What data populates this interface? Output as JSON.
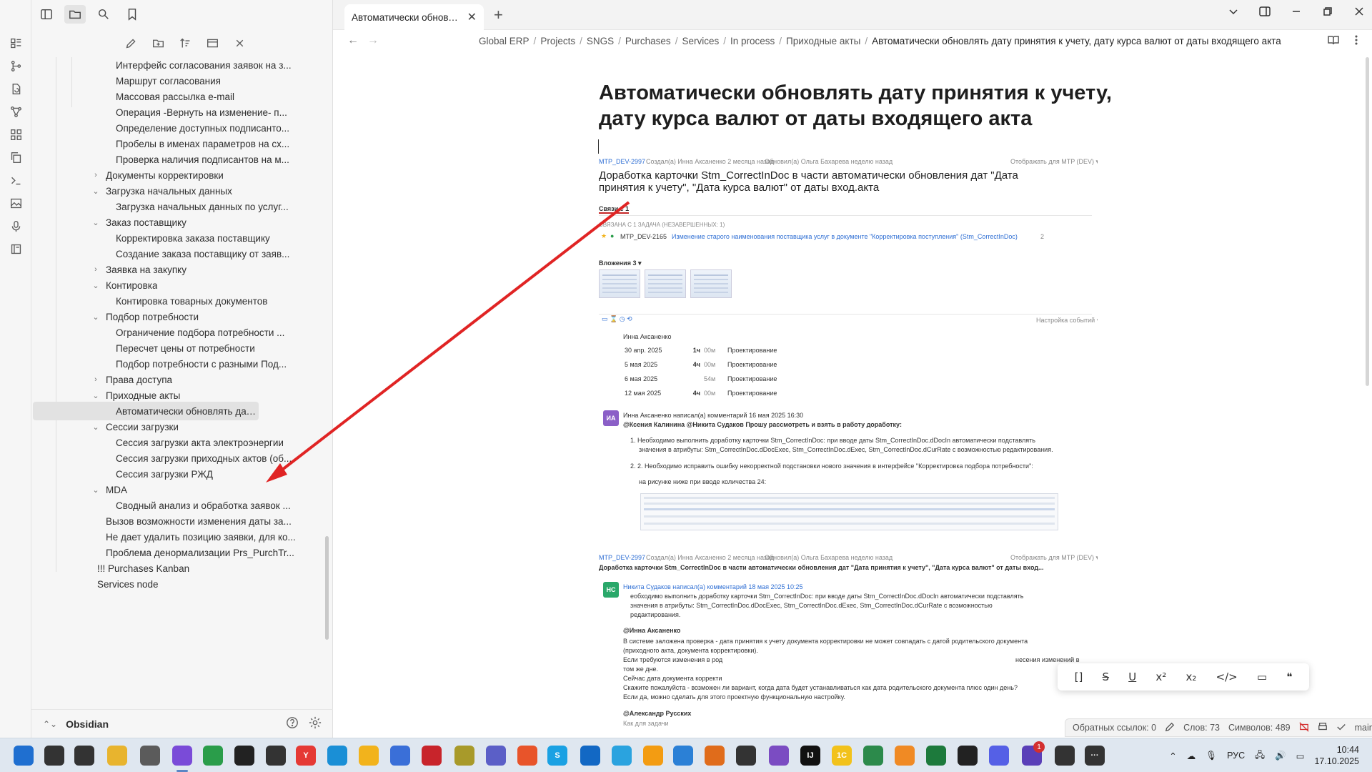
{
  "ribbon": {
    "icons": [
      "dashboard-icon",
      "git-icon",
      "document-refresh-icon",
      "graph-icon",
      "grid-icon",
      "copy-icon",
      "terminal-icon",
      "image-icon",
      "microphone-icon",
      "book-icon"
    ]
  },
  "sidebar": {
    "top_icons": [
      "sidebar-toggle-icon",
      "folder-icon",
      "search-icon",
      "bookmark-icon"
    ],
    "actions": [
      "new-note-icon",
      "new-folder-icon",
      "sort-icon",
      "collapse-icon",
      "close-all-icon"
    ],
    "tree": [
      {
        "label": "Интерфейс согласования заявок на з...",
        "level": 2,
        "folder": false
      },
      {
        "label": "Маршрут согласования",
        "level": 2,
        "folder": false
      },
      {
        "label": "Массовая рассылка e-mail",
        "level": 2,
        "folder": false
      },
      {
        "label": "Операция -Вернуть на изменение- п...",
        "level": 2,
        "folder": false
      },
      {
        "label": "Определение доступных подписанто...",
        "level": 2,
        "folder": false
      },
      {
        "label": "Пробелы в именах параметров на сх...",
        "level": 2,
        "folder": false
      },
      {
        "label": "Проверка наличия подписантов на м...",
        "level": 2,
        "folder": false
      },
      {
        "label": "Документы корректировки",
        "level": 1,
        "folder": true,
        "open": false
      },
      {
        "label": "Загрузка начальных данных",
        "level": 1,
        "folder": true,
        "open": true
      },
      {
        "label": "Загрузка начальных данных по услуг...",
        "level": 2,
        "folder": false
      },
      {
        "label": "Заказ поставщику",
        "level": 1,
        "folder": true,
        "open": true
      },
      {
        "label": "Корректировка заказа поставщику",
        "level": 2,
        "folder": false
      },
      {
        "label": "Создание заказа поставщику от заяв...",
        "level": 2,
        "folder": false
      },
      {
        "label": "Заявка на закупку",
        "level": 1,
        "folder": true,
        "open": false
      },
      {
        "label": "Контировка",
        "level": 1,
        "folder": true,
        "open": true
      },
      {
        "label": "Контировка товарных документов",
        "level": 2,
        "folder": false
      },
      {
        "label": "Подбор потребности",
        "level": 1,
        "folder": true,
        "open": true
      },
      {
        "label": "Ограничение подбора потребности ...",
        "level": 2,
        "folder": false
      },
      {
        "label": "Пересчет цены от потребности",
        "level": 2,
        "folder": false
      },
      {
        "label": "Подбор потребности с разными Под...",
        "level": 2,
        "folder": false
      },
      {
        "label": "Права доступа",
        "level": 1,
        "folder": true,
        "open": false
      },
      {
        "label": "Приходные акты",
        "level": 1,
        "folder": true,
        "open": true
      },
      {
        "label": "Автоматически обновлять дату прин...",
        "level": 2,
        "folder": false,
        "selected": true
      },
      {
        "label": "Сессии загрузки",
        "level": 1,
        "folder": true,
        "open": true
      },
      {
        "label": "Сессия загрузки акта электроэнергии",
        "level": 2,
        "folder": false
      },
      {
        "label": "Сессия загрузки приходных актов (об...",
        "level": 2,
        "folder": false
      },
      {
        "label": "Сессия загрузки РЖД",
        "level": 2,
        "folder": false
      },
      {
        "label": "MDA",
        "level": 1,
        "folder": true,
        "open": true
      },
      {
        "label": "Сводный анализ и обработка заявок ...",
        "level": 2,
        "folder": false
      },
      {
        "label": "Вызов возможности изменения даты за...",
        "level": 1,
        "folder": false
      },
      {
        "label": "Не дает удалить позицию заявки, для ко...",
        "level": 1,
        "folder": false
      },
      {
        "label": "Проблема денормализации Prs_PurchTr...",
        "level": 1,
        "folder": false
      },
      {
        "label": "!!! Purchases Kanban",
        "level": 0,
        "folder": false
      },
      {
        "label": "Services node",
        "level": 0,
        "folder": false
      }
    ],
    "vault_name": "Obsidian"
  },
  "tabs": [
    {
      "title": "Автоматически обновлят",
      "active": true
    }
  ],
  "breadcrumb": [
    "Global ERP",
    "Projects",
    "SNGS",
    "Purchases",
    "Services",
    "In process",
    "Приходные акты",
    "Автоматически обновлять дату принятия к учету, дату курса валют от даты входящего акта"
  ],
  "note": {
    "title": "Автоматически обновлять дату принятия к учету, дату курса валют от даты входящего акта"
  },
  "embed": {
    "key": "MTP_DEV-2997",
    "created": "Создал(а) Инна Аксаненко 2 месяца назад",
    "updated": "Обновил(а) Ольга Бахарева неделю назад",
    "visibility": "Отображать для MTP (DEV) ▾",
    "issue_title": "Доработка карточки Stm_CorrectInDoc в части автоматически обновления дат \"Дата принятия к учету\", \"Дата курса валют\" от даты вход.акта",
    "links_tab": "Связи с 1",
    "linked_header": "СВЯЗАНА С 1 ЗАДАЧА (НЕЗАВЕРШЕННЫХ: 1)",
    "linked_key": "MTP_DEV-2165",
    "linked_title": "Изменение старого наименования поставщика услуг в документе \"Корректировка поступления\" (Stm_CorrectInDoc)",
    "linked_count": "2",
    "attachments": "Вложения 3 ▾",
    "events_settings": "Настройка событий ▾",
    "worklog_user": "Инна Аксаненко",
    "worklog": [
      {
        "date": "30 апр. 2025",
        "h": "1ч",
        "m": "00м",
        "activity": "Проектирование"
      },
      {
        "date": "5 мая 2025",
        "h": "4ч",
        "m": "00м",
        "activity": "Проектирование"
      },
      {
        "date": "6 мая 2025",
        "h": "",
        "m": "54м",
        "activity": "Проектирование"
      },
      {
        "date": "12 мая 2025",
        "h": "4ч",
        "m": "00м",
        "activity": "Проектирование"
      }
    ],
    "comment1_avatar": "ИА",
    "comment1_header": "Инна Аксаненко написал(а) комментарий 16 мая 2025 16:30",
    "comment1_mention": "@Ксения Калинина @Никита Судаков Прошу рассмотреть и взять в работу доработку:",
    "comment1_item1": "1. Необходимо выполнить доработку карточки Stm_CorrectInDoc: при вводе даты Stm_CorrectInDoc.dDocIn автоматически подставлять",
    "comment1_item1b": "значения в атрибуты: Stm_CorrectInDoc.dDocExec, Stm_CorrectInDoc.dExec, Stm_CorrectInDoc.dCurRate с возможностью редактирования.",
    "comment1_item2": "2.   2. Необходимо исправить ошибку некорректной подстановки нового значения в интерфейсе \"Корректировка подбора потребности\":",
    "comment1_item2b": "на рисунке ниже при вводе количества 24:",
    "key2": "MTP_DEV-2997",
    "created2": "Создал(а) Инна Аксаненко 2 месяца назад",
    "updated2": "Обновил(а) Ольга Бахарева неделю назад",
    "visibility2": "Отображать для MTP (DEV) ▾",
    "issue_title2": "Доработка карточки Stm_CorrectInDoc в части автоматически обновления дат \"Дата принятия к учету\", \"Дата курса валют\" от даты вход...",
    "comment2_avatar": "НС",
    "comment2_header": "Никита Судаков написал(а) комментарий 18 мая 2025 10:25",
    "comment2_l1": "еобходимо выполнить доработку карточки Stm_CorrectInDoc: при вводе даты Stm_CorrectInDoc.dDocIn автоматически подставлять",
    "comment2_l2": "значения в атрибуты: Stm_CorrectInDoc.dDocExec, Stm_CorrectInDoc.dExec, Stm_CorrectInDoc.dCurRate с возможностью",
    "comment2_l3": "редактирования.",
    "comment2_at": "@Инна Аксаненко",
    "comment2_l4": "В системе заложена проверка - дата принятия к учету документа корректировки не может совпадать с датой родительского документа",
    "comment2_l5": "(приходного акта, документа корректировки).",
    "comment2_l6": "Если требуются изменения в род",
    "comment2_l6b": "несения изменений в",
    "comment2_l7": "том же дне.",
    "comment2_l8": "Сейчас дата документа корректи",
    "comment2_l9": "Скажите пожалуйста - возможен ли вариант, когда дата будет устанавливаться как дата родительского документа плюс один день?",
    "comment2_l10": "Если да, можно сделать для этого проектную функциональную настройку.",
    "comment3_author": "@Александр Русских",
    "comment3_sub": "Как для задачи"
  },
  "format_toolbar": [
    "[]",
    "S",
    "U",
    "x²",
    "x₂",
    "</>",
    "▭",
    "❝"
  ],
  "status": {
    "backlinks": "Обратных ссылок: 0",
    "words": "Слов: 73",
    "chars": "Символов: 489",
    "branch": "main"
  },
  "taskbar": {
    "apps": [
      {
        "name": "start-icon",
        "color": "#1f6fd0",
        "label": ""
      },
      {
        "name": "search-icon",
        "color": "#333333",
        "label": ""
      },
      {
        "name": "task-view-icon",
        "color": "#333333",
        "label": ""
      },
      {
        "name": "file-explorer-icon",
        "color": "#e8b42e",
        "label": ""
      },
      {
        "name": "notepad-icon",
        "color": "#5b5b5b",
        "label": ""
      },
      {
        "name": "obsidian-icon",
        "color": "#7a4bd8",
        "label": ""
      },
      {
        "name": "chrome-icon",
        "color": "#2a9d4a",
        "label": ""
      },
      {
        "name": "github-icon",
        "color": "#222222",
        "label": ""
      },
      {
        "name": "shield-icon",
        "color": "#333333",
        "label": ""
      },
      {
        "name": "yandex-icon",
        "color": "#e53935",
        "label": "Y"
      },
      {
        "name": "edge-icon",
        "color": "#1a8fd6",
        "label": ""
      },
      {
        "name": "chrome2-icon",
        "color": "#f2b31c",
        "label": ""
      },
      {
        "name": "cube-icon",
        "color": "#3a6fd8",
        "label": ""
      },
      {
        "name": "pdf-icon",
        "color": "#c8242b",
        "label": ""
      },
      {
        "name": "far-icon",
        "color": "#a89a2a",
        "label": ""
      },
      {
        "name": "teams-icon",
        "color": "#5b5fc7",
        "label": ""
      },
      {
        "name": "firefox-icon",
        "color": "#e8542a",
        "label": ""
      },
      {
        "name": "skype-icon",
        "color": "#1aa1e3",
        "label": "S"
      },
      {
        "name": "outlook-icon",
        "color": "#1268c4",
        "label": ""
      },
      {
        "name": "telegram-icon",
        "color": "#2aa3df",
        "label": ""
      },
      {
        "name": "mosaic-icon",
        "color": "#f39c12",
        "label": ""
      },
      {
        "name": "remote-icon",
        "color": "#2b80d6",
        "label": ""
      },
      {
        "name": "sublime-icon",
        "color": "#e06c1b",
        "label": ""
      },
      {
        "name": "pg-icon",
        "color": "#333333",
        "label": ""
      },
      {
        "name": "vs-icon",
        "color": "#7b4cc2",
        "label": ""
      },
      {
        "name": "jetbrains-icon",
        "color": "#111111",
        "label": "IJ"
      },
      {
        "name": "1c-icon",
        "color": "#f2c21b",
        "label": "1С"
      },
      {
        "name": "excel-db-icon",
        "color": "#2c8a4b",
        "label": ""
      },
      {
        "name": "vlc-icon",
        "color": "#f08a24",
        "label": ""
      },
      {
        "name": "excel-icon",
        "color": "#1d7a3c",
        "label": ""
      },
      {
        "name": "chat-icon",
        "color": "#222222",
        "label": ""
      },
      {
        "name": "messenger-icon",
        "color": "#5560e6",
        "label": ""
      },
      {
        "name": "github-desktop-icon",
        "color": "#5a3fb8",
        "label": ""
      },
      {
        "name": "pgadmin-icon",
        "color": "#333333",
        "label": ""
      },
      {
        "name": "more-icon",
        "color": "#333333",
        "label": "···"
      }
    ],
    "badge": "1",
    "lang": "РУС",
    "time": "10:44",
    "date": "17.10.2025"
  }
}
